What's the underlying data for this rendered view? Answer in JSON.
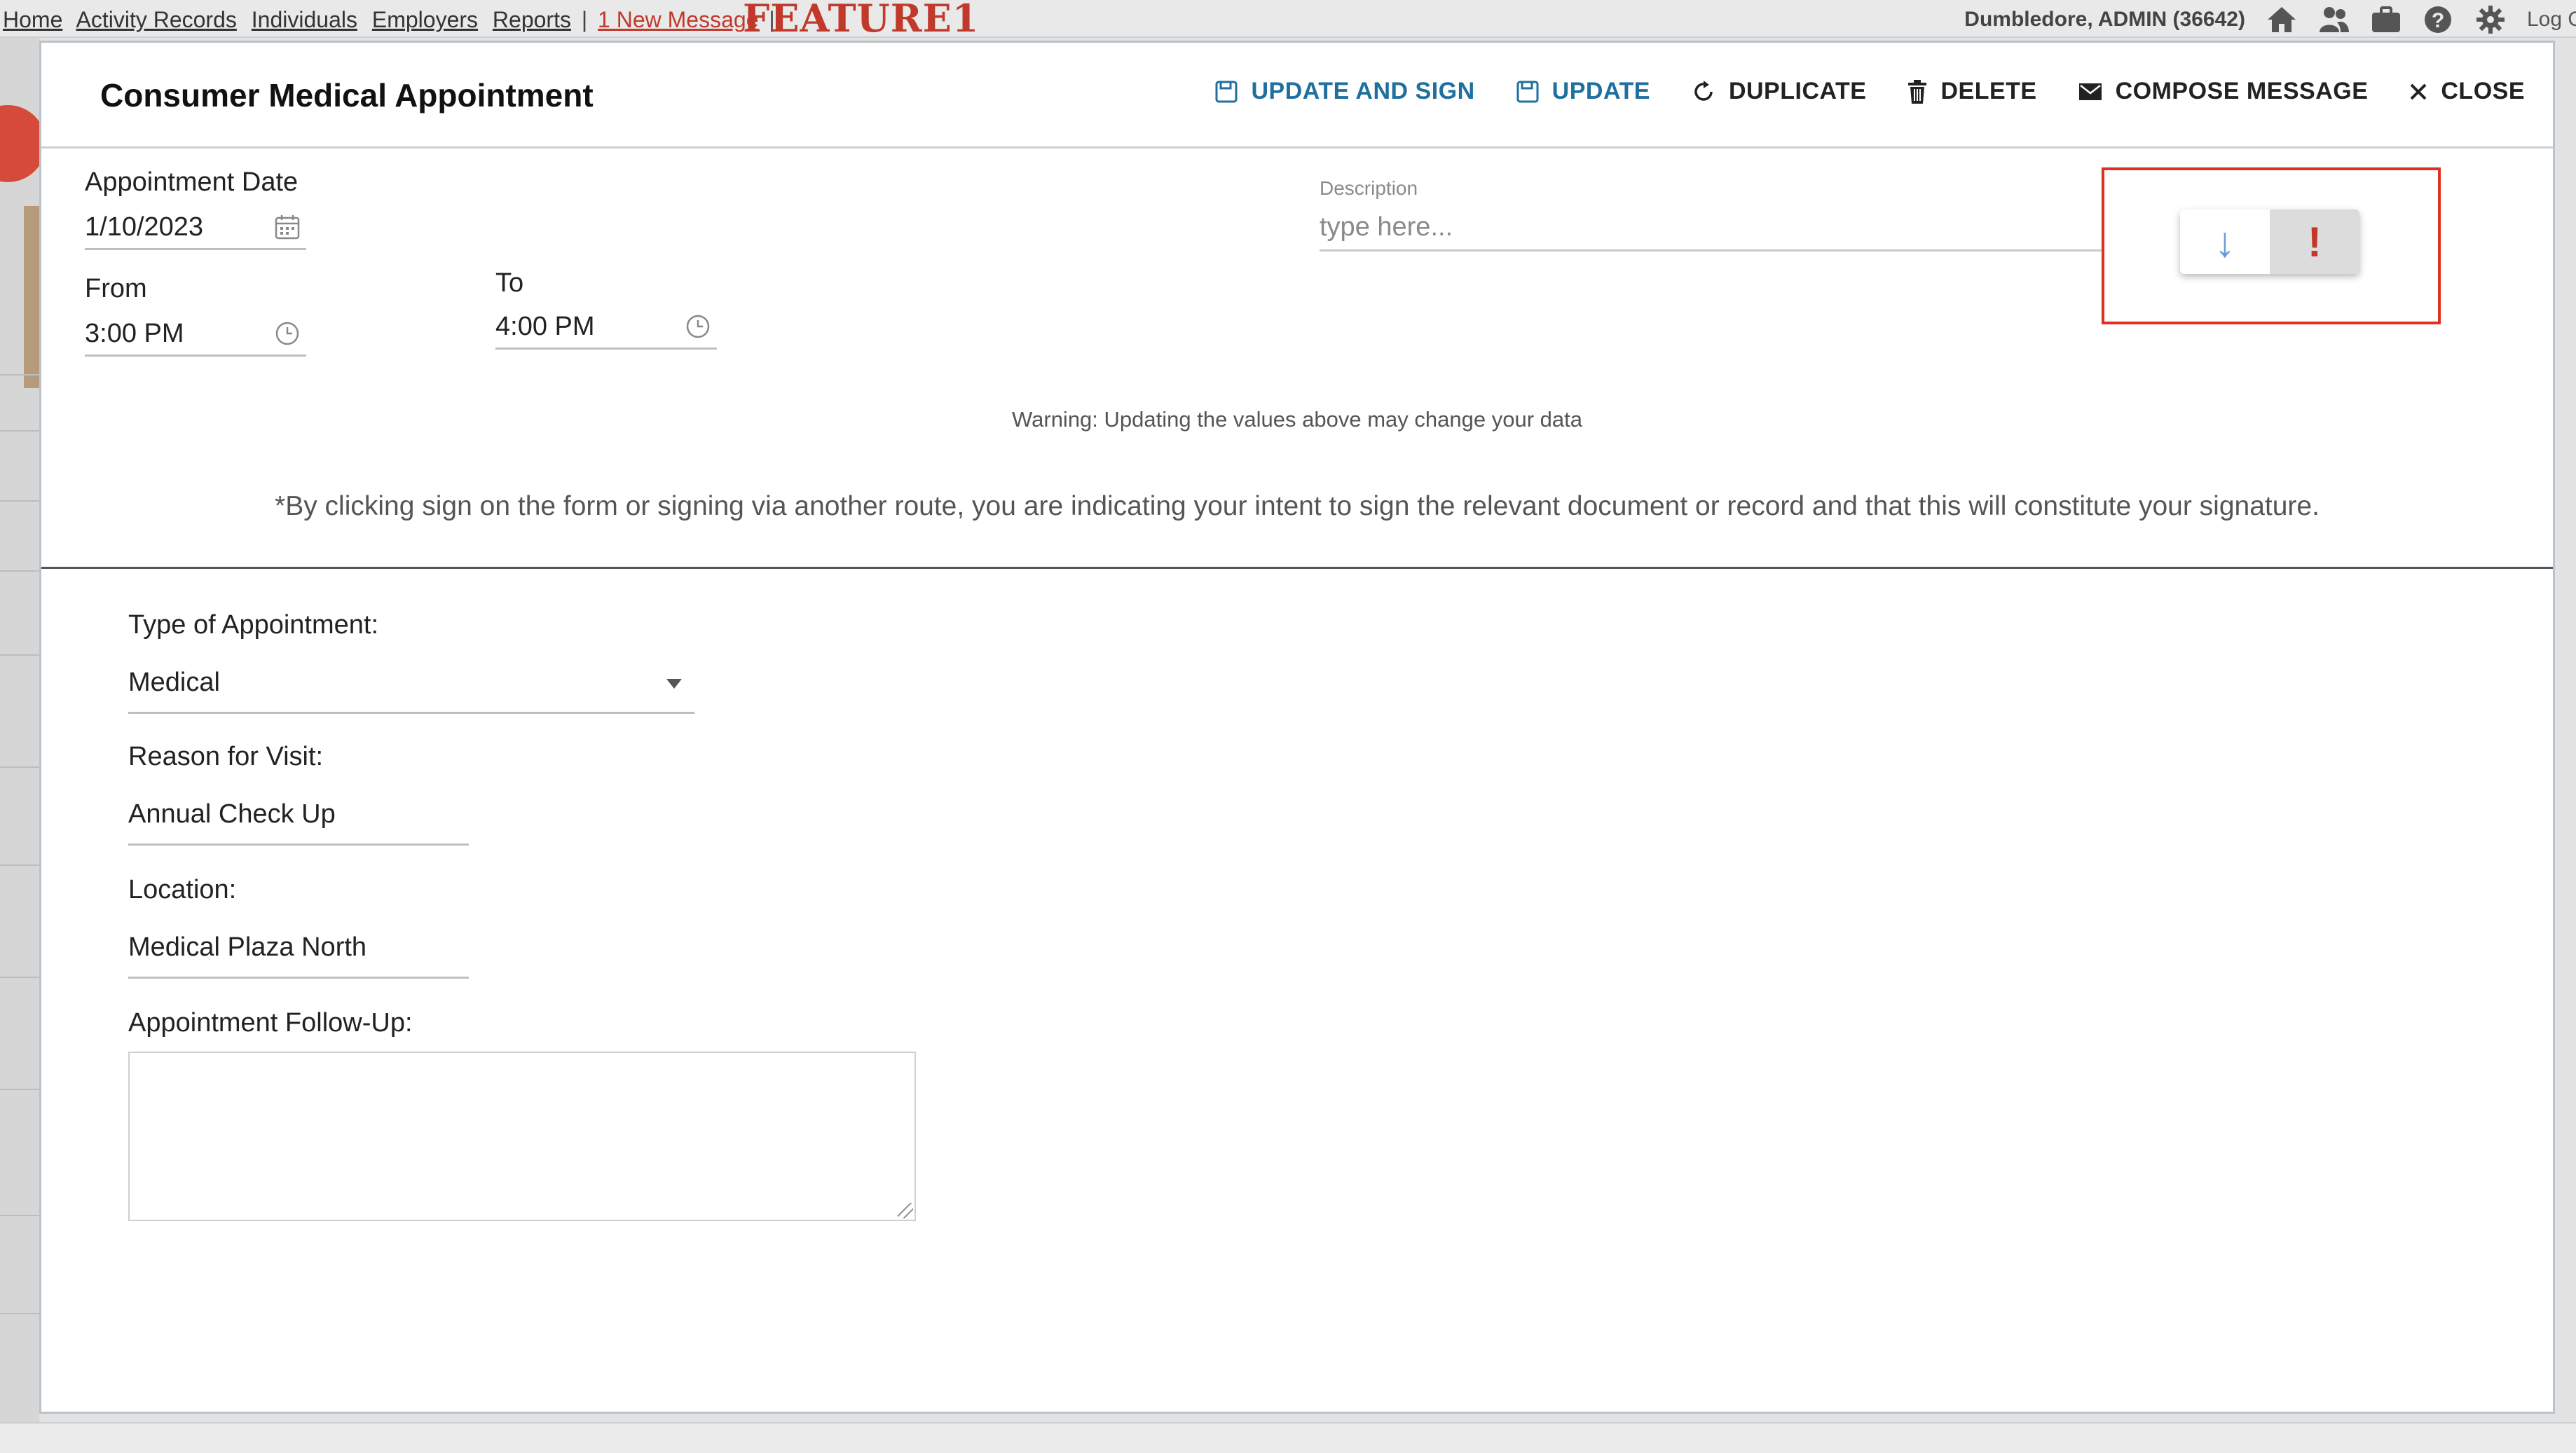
{
  "nav": {
    "links": [
      "Home",
      "Activity Records",
      "Individuals",
      "Employers",
      "Reports"
    ],
    "separator": "|",
    "new_message": "1 New Message",
    "feature": "FEATURE1",
    "user": "Dumbledore, ADMIN  (36642)",
    "logout": "Log Out",
    "icons": [
      "home-icon",
      "people-icon",
      "briefcase-icon",
      "help-icon",
      "gear-icon"
    ]
  },
  "modal": {
    "title": "Consumer Medical Appointment",
    "actions": {
      "update_and_sign": "UPDATE AND SIGN",
      "update": "UPDATE",
      "duplicate": "DUPLICATE",
      "delete": "DELETE",
      "compose": "COMPOSE MESSAGE",
      "close": "CLOSE"
    },
    "appointment_date": {
      "label": "Appointment Date",
      "value": "1/10/2023"
    },
    "from": {
      "label": "From",
      "value": "3:00 PM"
    },
    "to": {
      "label": "To",
      "value": "4:00 PM"
    },
    "description": {
      "label": "Description",
      "placeholder": "type here..."
    },
    "toggle": {
      "down": "↓",
      "important": "!"
    },
    "warning": "Warning: Updating the values above may change your data",
    "signature_notice": "*By clicking sign on the form or signing via another route, you are indicating your intent to sign the relevant document or record and that this will constitute your signature.",
    "type_of_appointment": {
      "label": "Type of Appointment:",
      "value": "Medical"
    },
    "reason": {
      "label": "Reason for Visit:",
      "value": "Annual Check Up"
    },
    "location": {
      "label": "Location:",
      "value": "Medical Plaza North"
    },
    "follow_up": {
      "label": "Appointment Follow-Up:",
      "value": ""
    }
  },
  "colors": {
    "accent_blue": "#1f6f9f",
    "alert_red": "#c0392b",
    "highlight_box": "#e0301e"
  }
}
